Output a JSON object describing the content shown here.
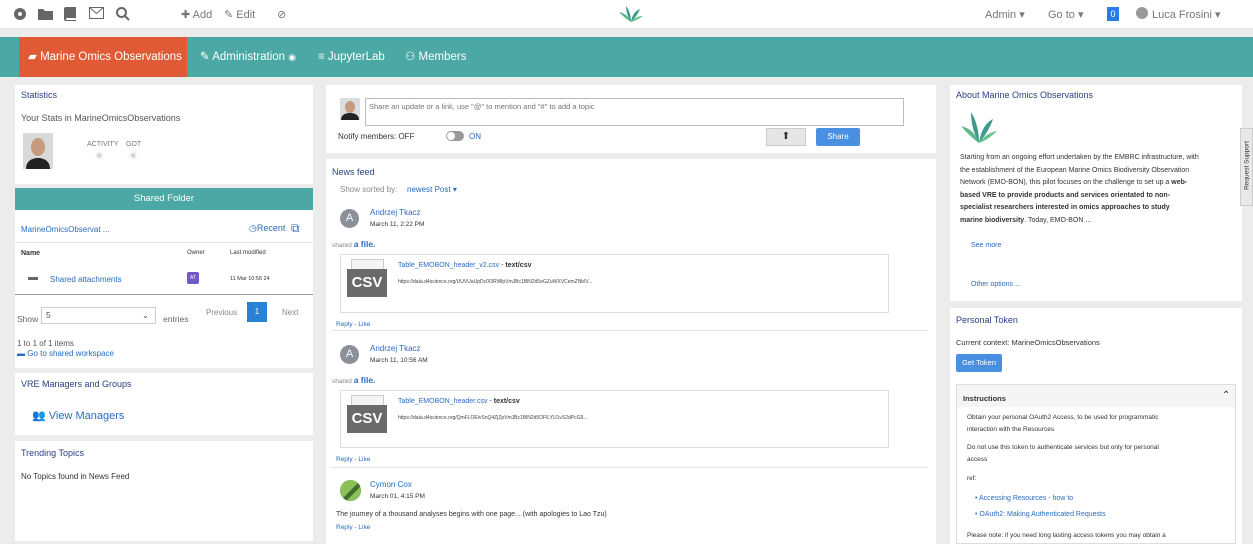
{
  "topbar": {
    "add_label": "Add",
    "edit_label": "Edit",
    "admin_label": "Admin",
    "goto_label": "Go to",
    "notif_count": "0",
    "user_name": "Luca Frosini"
  },
  "nav": {
    "items": [
      "Marine Omics Observations",
      "Administration",
      "JupyterLab",
      "Members"
    ]
  },
  "stats": {
    "title": "Statistics",
    "subtitle": "Your Stats in MarineOmicsObservations",
    "activity": "ACTIVITY",
    "got": "GOT"
  },
  "folder": {
    "header": "Shared Folder",
    "path": "MarineOmicsObservat ...",
    "recent": "Recent",
    "col_name": "Name",
    "col_owner": "Owner",
    "col_modified": "Last modified",
    "row_name": "Shared attachments",
    "row_owner": "AT",
    "row_modified": "11 Mar 10:56 24",
    "show": "Show",
    "show_value": "5",
    "entries": "entries",
    "previous": "Previous",
    "page": "1",
    "next": "Next",
    "count": "1 to 1 of 1 items",
    "goto": "Go to shared workspace"
  },
  "managers": {
    "title": "VRE Managers and Groups",
    "link": "View Managers"
  },
  "trending": {
    "title": "Trending Topics",
    "empty": "No Topics found in News Feed"
  },
  "share": {
    "placeholder": "Share an update or a link, use \"@\" to mention and \"#\" to add a topic",
    "notify": "Notify members: OFF",
    "on": "ON",
    "share_btn": "Share"
  },
  "feed": {
    "title": "News feed",
    "sorted_label": "Show sorted by:",
    "sorted_value": "newest Post",
    "posts": [
      {
        "author": "Andrzej Tkacz",
        "date": "March 11, 2:22 PM",
        "shared": "shared",
        "afile": "a file.",
        "fname": "Table_EMOBON_header_v2.csv",
        "ftype": "text/csv",
        "url": "https://data.d4science.org/UUVUaUpDc0I3RWlpVmJBc1BlN2d5eGZuWXVCemZNblV...",
        "reply": "Reply",
        "like": "Like"
      },
      {
        "author": "Andrzej Tkacz",
        "date": "March 11, 10:56 AM",
        "shared": "shared",
        "afile": "a file.",
        "fname": "Table_EMOBON_header.csv",
        "ftype": "text/csv",
        "url": "https://data.d4science.org/QmFLOElvSnQ4ZjZpVmJBc1BlN2d5OFlLYU1vS2dPcG9...",
        "reply": "Reply",
        "like": "Like"
      },
      {
        "author": "Cymon Cox",
        "date": "March 01, 4:15 PM",
        "text": "The journey of a thousand analyses begins with one page... (with apologies to Lao Tzu)",
        "reply": "Reply",
        "like": "Like"
      }
    ],
    "csv": "CSV",
    "dash": " - ",
    "sep": " - "
  },
  "about": {
    "title": "About Marine Omics Observations",
    "lines": [
      "Starting from an ongoing effort undertaken by the EMBRC infrastructure, with",
      "the establishment of the European Marine Omics Biodiversity Observation",
      "Network (EMO-BON), this pilot focuses on the challenge to set up a"
    ],
    "bold_web": "web-",
    "bold_lines": [
      "based VRE to provide products and services orientated to non-",
      "specialist researchers interested in omics approaches to study"
    ],
    "bold_last": "marine biodiversity",
    "tail": ". Today, EMO-BON ...",
    "see_more": "See more",
    "other": "Other options ..."
  },
  "support_tab": "Request Support",
  "token": {
    "title": "Personal Token",
    "context": "Current context: MarineOmicsObservations",
    "btn": "Get Token",
    "instr_title": "Instructions",
    "p1a": "Obtain your personal OAuth2 Access, to be used for programmatic",
    "p1b": "interaction with the Resources",
    "p2a": "Do not use this token to authenticate services but only for personal",
    "p2b": "access",
    "ref": "ref:",
    "link1": "Accessing Resources - how to",
    "link2": "OAuth2: Making Authenticated Requests",
    "note": "Please note: if you need long lasting access tokens you may obtain a"
  },
  "colors": {
    "accent": "#4ba8a4",
    "active": "#e05b35",
    "link": "#2a6bbf",
    "title": "#2a3f80",
    "button": "#4a90e2"
  }
}
